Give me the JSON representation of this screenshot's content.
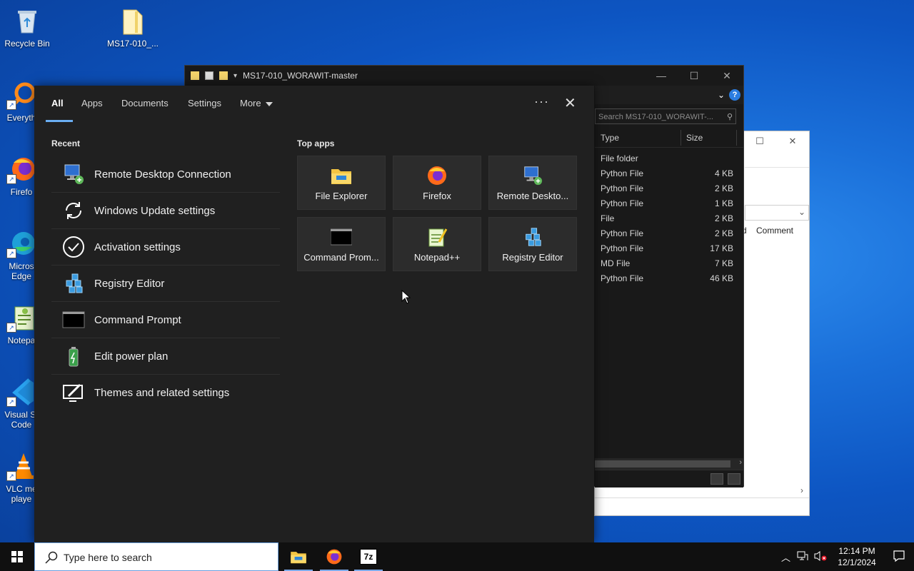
{
  "desktop": {
    "icons": [
      {
        "label": "Recycle Bin"
      },
      {
        "label": "MS17-010_..."
      },
      {
        "label": "Everyth"
      },
      {
        "label": "Firefo"
      },
      {
        "label": "Micros",
        "label2": "Edge"
      },
      {
        "label": "Notepa"
      },
      {
        "label": "Visual St",
        "label2": "Code"
      },
      {
        "label": "VLC me",
        "label2": "playe"
      }
    ]
  },
  "explorer": {
    "title": "MS17-010_WORAWIT-master",
    "search_placeholder": "Search MS17-010_WORAWIT-...",
    "columns": {
      "type": "Type",
      "size": "Size"
    },
    "rows": [
      {
        "type": "File folder",
        "size": ""
      },
      {
        "type": "Python File",
        "size": "4 KB"
      },
      {
        "type": "Python File",
        "size": "2 KB"
      },
      {
        "type": "Python File",
        "size": "1 KB"
      },
      {
        "type": "File",
        "size": "2 KB"
      },
      {
        "type": "Python File",
        "size": "2 KB"
      },
      {
        "type": "Python File",
        "size": "17 KB"
      },
      {
        "type": "MD File",
        "size": "7 KB"
      },
      {
        "type": "Python File",
        "size": "46 KB"
      }
    ],
    "help": "?"
  },
  "bg_window": {
    "comment_header": "Comment",
    "d_char": "d"
  },
  "search_panel": {
    "tabs": [
      {
        "label": "All"
      },
      {
        "label": "Apps"
      },
      {
        "label": "Documents"
      },
      {
        "label": "Settings"
      },
      {
        "label": "More"
      }
    ],
    "more_options": "···",
    "recent_label": "Recent",
    "recent": [
      {
        "label": "Remote Desktop Connection",
        "icon": "remote-desktop-icon"
      },
      {
        "label": "Windows Update settings",
        "icon": "sync-icon"
      },
      {
        "label": "Activation settings",
        "icon": "check-circle-icon"
      },
      {
        "label": "Registry Editor",
        "icon": "registry-icon"
      },
      {
        "label": "Command Prompt",
        "icon": "cmd-icon"
      },
      {
        "label": "Edit power plan",
        "icon": "battery-icon"
      },
      {
        "label": "Themes and related settings",
        "icon": "brush-icon"
      }
    ],
    "top_apps_label": "Top apps",
    "top_apps": [
      {
        "label": "File Explorer",
        "icon": "folder-icon"
      },
      {
        "label": "Firefox",
        "icon": "firefox-icon"
      },
      {
        "label": "Remote Deskto...",
        "icon": "remote-desktop-icon"
      },
      {
        "label": "Command Prom...",
        "icon": "cmd-icon"
      },
      {
        "label": "Notepad++",
        "icon": "notepadpp-icon"
      },
      {
        "label": "Registry Editor",
        "icon": "registry-icon"
      }
    ]
  },
  "taskbar": {
    "search_placeholder": "Type here to search",
    "apps": [
      {
        "name": "file-explorer"
      },
      {
        "name": "firefox"
      },
      {
        "name": "7-zip",
        "label": "7z"
      }
    ],
    "time": "12:14 PM",
    "date": "12/1/2024"
  },
  "colors": {
    "accent": "#6aaef2",
    "panel_bg": "#202020",
    "tile_bg": "#2c2c2c"
  }
}
